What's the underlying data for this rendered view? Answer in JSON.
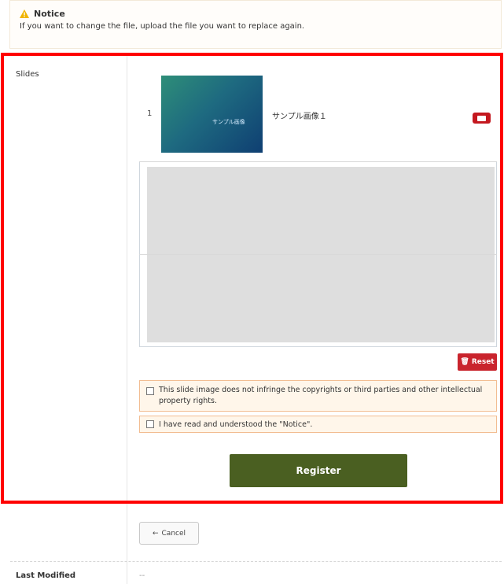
{
  "notice": {
    "title": "Notice",
    "text": "If you want to change the file, upload the file you want to replace again."
  },
  "form": {
    "slides_label": "Slides",
    "slides": [
      {
        "index": "1",
        "name": "サンプル画像１",
        "thumbnail_text": "サンプル画像"
      }
    ],
    "reset_label": "Reset",
    "agreement_copyright": "This slide image does not infringe the copyrights or third parties and other intellectual property rights.",
    "agreement_notice": "I have read and understood the \"Notice\".",
    "register_label": "Register",
    "cancel_label": "Cancel",
    "last_modified_label": "Last Modified",
    "last_modified_value": "--"
  },
  "colors": {
    "highlight_border": "#ff0000",
    "register_bg": "#4a5f21",
    "delete_bg": "#c4181f",
    "reset_bg": "#c9242d",
    "agreement_border": "#f2bd92"
  }
}
